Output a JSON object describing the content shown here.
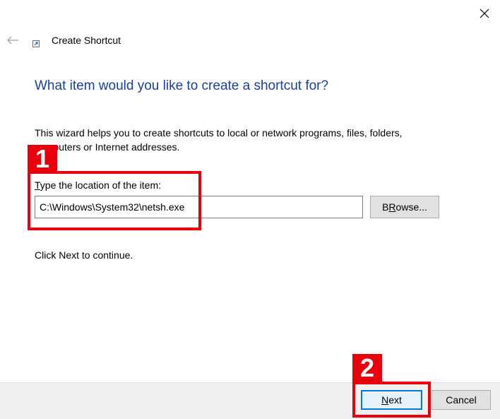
{
  "window": {
    "title": "Create Shortcut",
    "back_icon": "back-arrow-icon",
    "close_icon": "close-icon",
    "app_icon": "shortcut-icon"
  },
  "main": {
    "heading": "What item would you like to create a shortcut for?",
    "description": "This wizard helps you to create shortcuts to local or network programs, files, folders, computers or Internet addresses.",
    "location_label_accel": "T",
    "location_label_rest": "ype the location of the item:",
    "location_value": "C:\\Windows\\System32\\netsh.exe",
    "browse_accel": "R",
    "browse_pre": "B",
    "browse_post": "owse...",
    "continue_text": "Click Next to continue."
  },
  "footer": {
    "next_accel": "N",
    "next_rest": "ext",
    "cancel_label": "Cancel"
  },
  "annotations": {
    "step1": "1",
    "step2": "2",
    "color": "#e8000d"
  },
  "colors": {
    "heading": "#1a3f9c",
    "footer_bg": "#f0f0f0",
    "focus_border": "#0078d7"
  }
}
